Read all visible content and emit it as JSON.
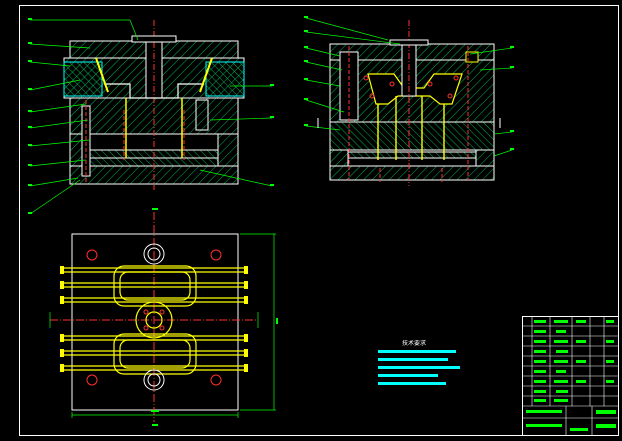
{
  "drawing": {
    "background_color": "#000000",
    "frame_color": "#ffffff",
    "hatch_color": "#00b050",
    "outline_color": "#ffffff",
    "centerline_color": "#ff3030",
    "leader_color": "#00ff00",
    "ejector_color": "#ffff00",
    "notes_color": "#00ffff"
  },
  "tech_notes": {
    "title": "技术要求"
  }
}
